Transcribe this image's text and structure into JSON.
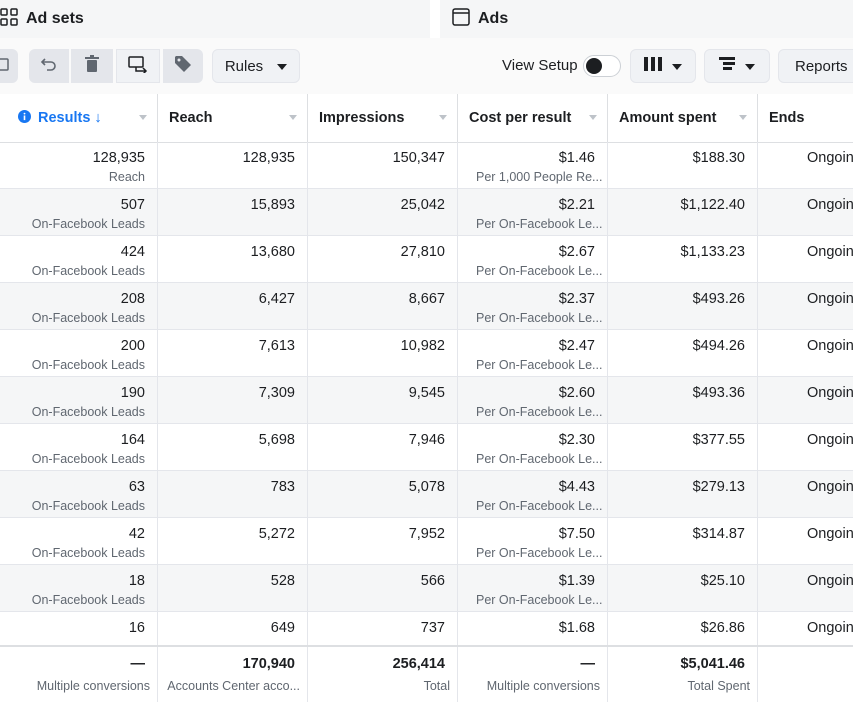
{
  "tabs": {
    "adsets": {
      "label": "Ad sets",
      "icon": "grid-icon"
    },
    "ads": {
      "label": "Ads",
      "icon": "window-icon"
    }
  },
  "toolbar": {
    "rules_label": "Rules",
    "view_setup_label": "View Setup",
    "view_setup_enabled": false,
    "reports_label": "Reports"
  },
  "columns": {
    "results": "Results ↓",
    "reach": "Reach",
    "impressions": "Impressions",
    "cost_per_result": "Cost per result",
    "amount_spent": "Amount spent",
    "ends": "Ends"
  },
  "rows": [
    {
      "results": "128,935",
      "results_sub": "Reach",
      "reach": "128,935",
      "impressions": "150,347",
      "cost": "$1.46",
      "cost_sub": "Per 1,000 People Re...",
      "spent": "$188.30",
      "ends": "Ongoin"
    },
    {
      "results": "507",
      "results_sub": "On-Facebook Leads",
      "reach": "15,893",
      "impressions": "25,042",
      "cost": "$2.21",
      "cost_sub": "Per On-Facebook Le...",
      "spent": "$1,122.40",
      "ends": "Ongoin"
    },
    {
      "results": "424",
      "results_sub": "On-Facebook Leads",
      "reach": "13,680",
      "impressions": "27,810",
      "cost": "$2.67",
      "cost_sub": "Per On-Facebook Le...",
      "spent": "$1,133.23",
      "ends": "Ongoin"
    },
    {
      "results": "208",
      "results_sub": "On-Facebook Leads",
      "reach": "6,427",
      "impressions": "8,667",
      "cost": "$2.37",
      "cost_sub": "Per On-Facebook Le...",
      "spent": "$493.26",
      "ends": "Ongoin"
    },
    {
      "results": "200",
      "results_sub": "On-Facebook Leads",
      "reach": "7,613",
      "impressions": "10,982",
      "cost": "$2.47",
      "cost_sub": "Per On-Facebook Le...",
      "spent": "$494.26",
      "ends": "Ongoin"
    },
    {
      "results": "190",
      "results_sub": "On-Facebook Leads",
      "reach": "7,309",
      "impressions": "9,545",
      "cost": "$2.60",
      "cost_sub": "Per On-Facebook Le...",
      "spent": "$493.36",
      "ends": "Ongoin"
    },
    {
      "results": "164",
      "results_sub": "On-Facebook Leads",
      "reach": "5,698",
      "impressions": "7,946",
      "cost": "$2.30",
      "cost_sub": "Per On-Facebook Le...",
      "spent": "$377.55",
      "ends": "Ongoin"
    },
    {
      "results": "63",
      "results_sub": "On-Facebook Leads",
      "reach": "783",
      "impressions": "5,078",
      "cost": "$4.43",
      "cost_sub": "Per On-Facebook Le...",
      "spent": "$279.13",
      "ends": "Ongoin"
    },
    {
      "results": "42",
      "results_sub": "On-Facebook Leads",
      "reach": "5,272",
      "impressions": "7,952",
      "cost": "$7.50",
      "cost_sub": "Per On-Facebook Le...",
      "spent": "$314.87",
      "ends": "Ongoin"
    },
    {
      "results": "18",
      "results_sub": "On-Facebook Leads",
      "reach": "528",
      "impressions": "566",
      "cost": "$1.39",
      "cost_sub": "Per On-Facebook Le...",
      "spent": "$25.10",
      "ends": "Ongoin"
    },
    {
      "results": "16",
      "results_sub": "",
      "reach": "649",
      "impressions": "737",
      "cost": "$1.68",
      "cost_sub": "",
      "spent": "$26.86",
      "ends": "Ongoin"
    }
  ],
  "totals": {
    "results": "—",
    "results_sub": "Multiple conversions",
    "reach": "170,940",
    "reach_sub": "Accounts Center acco...",
    "impressions": "256,414",
    "impressions_sub": "Total",
    "cost": "—",
    "cost_sub": "Multiple conversions",
    "spent": "$5,041.46",
    "spent_sub": "Total Spent"
  },
  "colors": {
    "accent": "#1877f2",
    "text": "#1c1e21",
    "muted": "#606770",
    "alt_row": "#f5f6f7"
  }
}
